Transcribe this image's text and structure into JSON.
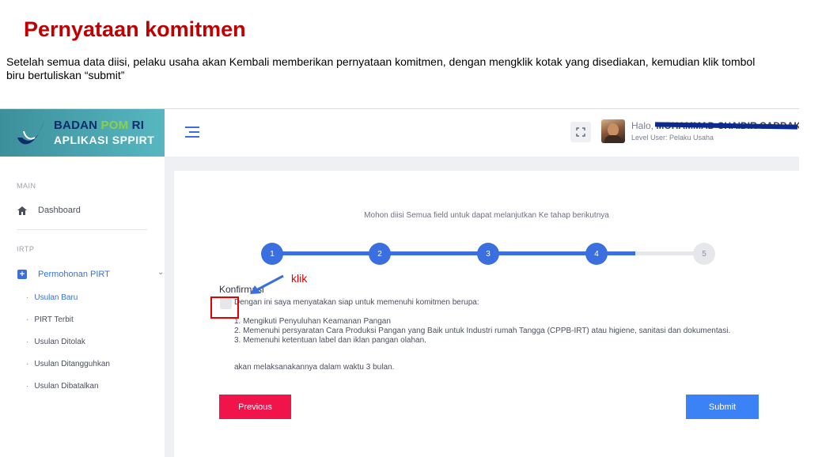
{
  "slide": {
    "title": "Pernyataan komitmen",
    "description": "Setelah semua data diisi, pelaku usaha akan Kembali memberikan pernyataan komitmen, dengan mengklik kotak yang disediakan, kemudian klik tombol biru bertuliskan “submit”"
  },
  "brand": {
    "line1_a": "BADAN ",
    "line1_b": "POM",
    "line1_c": " RI",
    "line2": "APLIKASI SPPIRT"
  },
  "header": {
    "greeting": "Halo, ",
    "user_name": "MOHAMMAD CHAIDIR CADDAK",
    "user_level": "Level User: Pelaku Usaha"
  },
  "sidebar": {
    "section_main": "MAIN",
    "dashboard": "Dashboard",
    "section_irtp": "IRTP",
    "permohonan": "Permohonan PIRT",
    "subitems": [
      {
        "label": "Usulan Baru"
      },
      {
        "label": "PIRT Terbit"
      },
      {
        "label": "Usulan Ditolak"
      },
      {
        "label": "Usulan Ditangguhkan"
      },
      {
        "label": "Usulan Dibatalkan"
      }
    ]
  },
  "wizard": {
    "instruction": "Mohon diisi Semua field untuk dapat melanjutkan Ke tahap berikutnya",
    "steps": [
      "1",
      "2",
      "3",
      "4",
      "5"
    ],
    "current_step": 4,
    "progress_fraction": 0.84
  },
  "form": {
    "konfirmasi_label": "Konfirmasi",
    "checkbox_text": "Dengan ini saya menyatakan siap untuk memenuhi komitmen berupa:",
    "commitments": [
      "1. Mengikuti Penyuluhan Keamanan Pangan",
      "2. Memenuhi persyaratan Cara Produksi Pangan yang Baik untuk Industri rumah Tangga (CPPB-IRT) atau higiene, sanitasi dan dokumentasi.",
      "3. Memenuhi ketentuan label dan iklan pangan olahan."
    ],
    "deadline": "akan melaksanakannya dalam waktu 3 bulan.",
    "previous_label": "Previous",
    "submit_label": "Submit"
  },
  "annotation": {
    "text": "klik"
  },
  "colors": {
    "accent": "#3b6fe0",
    "danger": "#f0144b",
    "submit": "#3b82f6",
    "title": "#c00000"
  }
}
